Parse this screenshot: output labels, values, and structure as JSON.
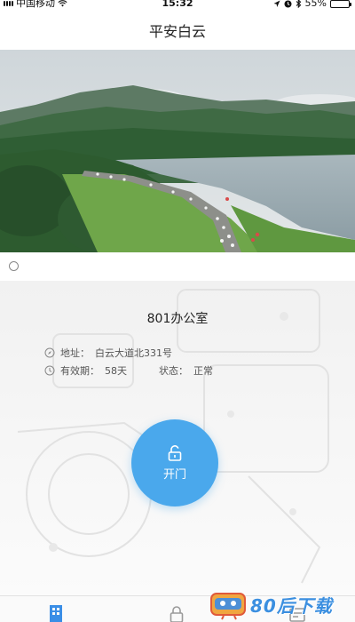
{
  "status_bar": {
    "carrier": "中国移动",
    "time": "15:32",
    "battery": "55%",
    "battery_level": 0.55
  },
  "header": {
    "title": "平安白云"
  },
  "banner": {
    "scene": "mountain lake landscape with crowd of runners on a lakeside road",
    "slide_count": 1
  },
  "room": {
    "name": "801办公室",
    "address_label": "地址：",
    "address_value": "白云大道北331号",
    "validity_label": "有效期：",
    "validity_value": "58天",
    "status_label": "状态：",
    "status_value": "正常"
  },
  "actions": {
    "open_label": "开门"
  },
  "tabs": [
    {
      "icon": "building-icon",
      "active": true
    },
    {
      "icon": "lock-icon",
      "active": false
    },
    {
      "icon": "card-icon",
      "active": false
    }
  ],
  "watermark": {
    "text": "80后下载"
  },
  "colors": {
    "accent": "#4aa8ec",
    "active_tab": "#3a8ee6",
    "inactive_tab": "#9a9a9a",
    "battery_fill": "#3cc13b",
    "watermark_blue": "#3b8fe0"
  }
}
